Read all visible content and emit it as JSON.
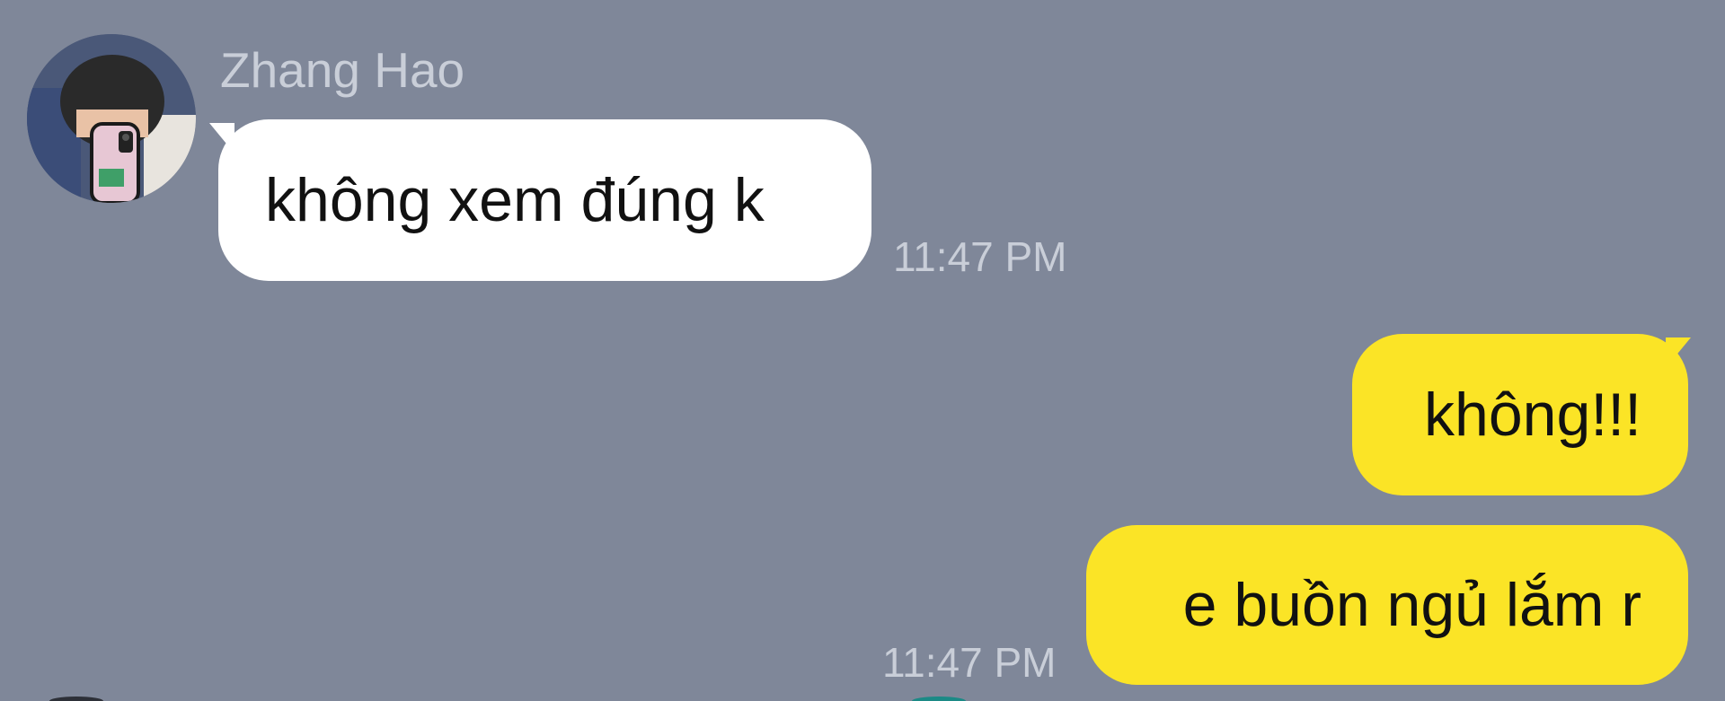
{
  "chat": {
    "incoming": {
      "sender_name": "Zhang Hao",
      "messages": [
        {
          "text": "không xem đúng k",
          "time": "11:47 PM"
        }
      ]
    },
    "outgoing": {
      "messages": [
        {
          "text": "không!!!"
        },
        {
          "text": "e buồn ngủ lắm r",
          "time": "11:47 PM"
        }
      ]
    }
  },
  "colors": {
    "background": "#7f8799",
    "incoming_bubble": "#ffffff",
    "outgoing_bubble": "#fbe426",
    "meta_text": "#c9ced8"
  }
}
